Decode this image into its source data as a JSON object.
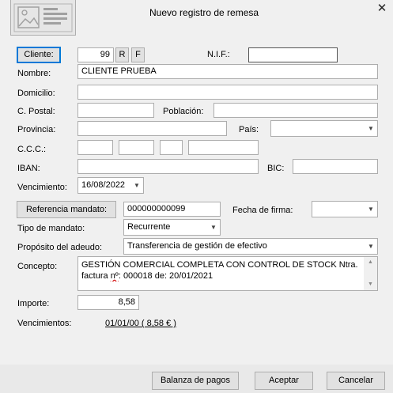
{
  "window": {
    "title": "Nuevo registro de remesa",
    "close_icon": "close-icon",
    "image_placeholder_icon": "image-placeholder-icon"
  },
  "form": {
    "cliente_button": "Cliente:",
    "cliente_value": "99",
    "r_button": "R",
    "f_button": "F",
    "nif_label": "N.I.F.:",
    "nif_value": "",
    "nombre_label": "Nombre:",
    "nombre_value": "CLIENTE PRUEBA",
    "domicilio_label": "Domicilio:",
    "domicilio_value": "",
    "cpostal_label": "C. Postal:",
    "cpostal_value": "",
    "poblacion_label": "Población:",
    "poblacion_value": "",
    "provincia_label": "Provincia:",
    "provincia_value": "",
    "pais_label": "País:",
    "pais_value": "",
    "ccc_label": "C.C.C.:",
    "ccc_values": [
      "",
      "",
      "",
      ""
    ],
    "iban_label": "IBAN:",
    "iban_value": "",
    "bic_label": "BIC:",
    "bic_value": "",
    "vencimiento_label": "Vencimiento:",
    "vencimiento_value": "16/08/2022",
    "referencia_button": "Referencia mandato:",
    "referencia_value": "000000000099",
    "fecha_firma_label": "Fecha de firma:",
    "fecha_firma_value": "",
    "tipo_mandato_label": "Tipo de mandato:",
    "tipo_mandato_value": "Recurrente",
    "proposito_label": "Propósito del adeudo:",
    "proposito_value": "Transferencia de gestión de efectivo",
    "concepto_label": "Concepto:",
    "concepto_line1": "GESTIÓN COMERCIAL COMPLETA CON CONTROL DE STOCK Ntra.",
    "concepto_line2_pre": "factura ",
    "concepto_line2_err": "nº",
    "concepto_line2_post": ": 000018 de: 20/01/2021",
    "importe_label": "Importe:",
    "importe_value": "8,58",
    "vencimientos_label": "Vencimientos:",
    "vencimientos_link": "01/01/00 ( 8,58 € )"
  },
  "footer": {
    "balanza_button": "Balanza de pagos",
    "aceptar_button": "Aceptar",
    "cancelar_button": "Cancelar"
  }
}
